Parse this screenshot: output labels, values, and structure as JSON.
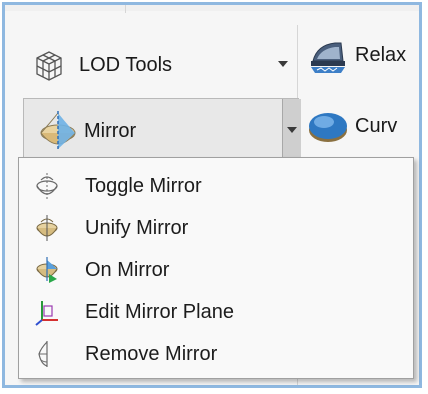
{
  "ribbon": {
    "lod_tools_label": "LOD Tools",
    "mirror_label": "Mirror",
    "right_column": [
      {
        "label": "Relax"
      },
      {
        "label": "Curv"
      }
    ]
  },
  "mirror_menu": {
    "items": [
      {
        "label": "Toggle Mirror",
        "icon": "toggle-mirror-icon"
      },
      {
        "label": "Unify Mirror",
        "icon": "unify-mirror-icon"
      },
      {
        "label": "On Mirror",
        "icon": "on-mirror-icon"
      },
      {
        "label": "Edit Mirror Plane",
        "icon": "edit-mirror-plane-icon"
      },
      {
        "label": "Remove Mirror",
        "icon": "remove-mirror-icon"
      }
    ]
  },
  "colors": {
    "frame_border": "#8fb8e0",
    "menu_background": "#f9f9f9",
    "text": "#1c1c1c"
  }
}
